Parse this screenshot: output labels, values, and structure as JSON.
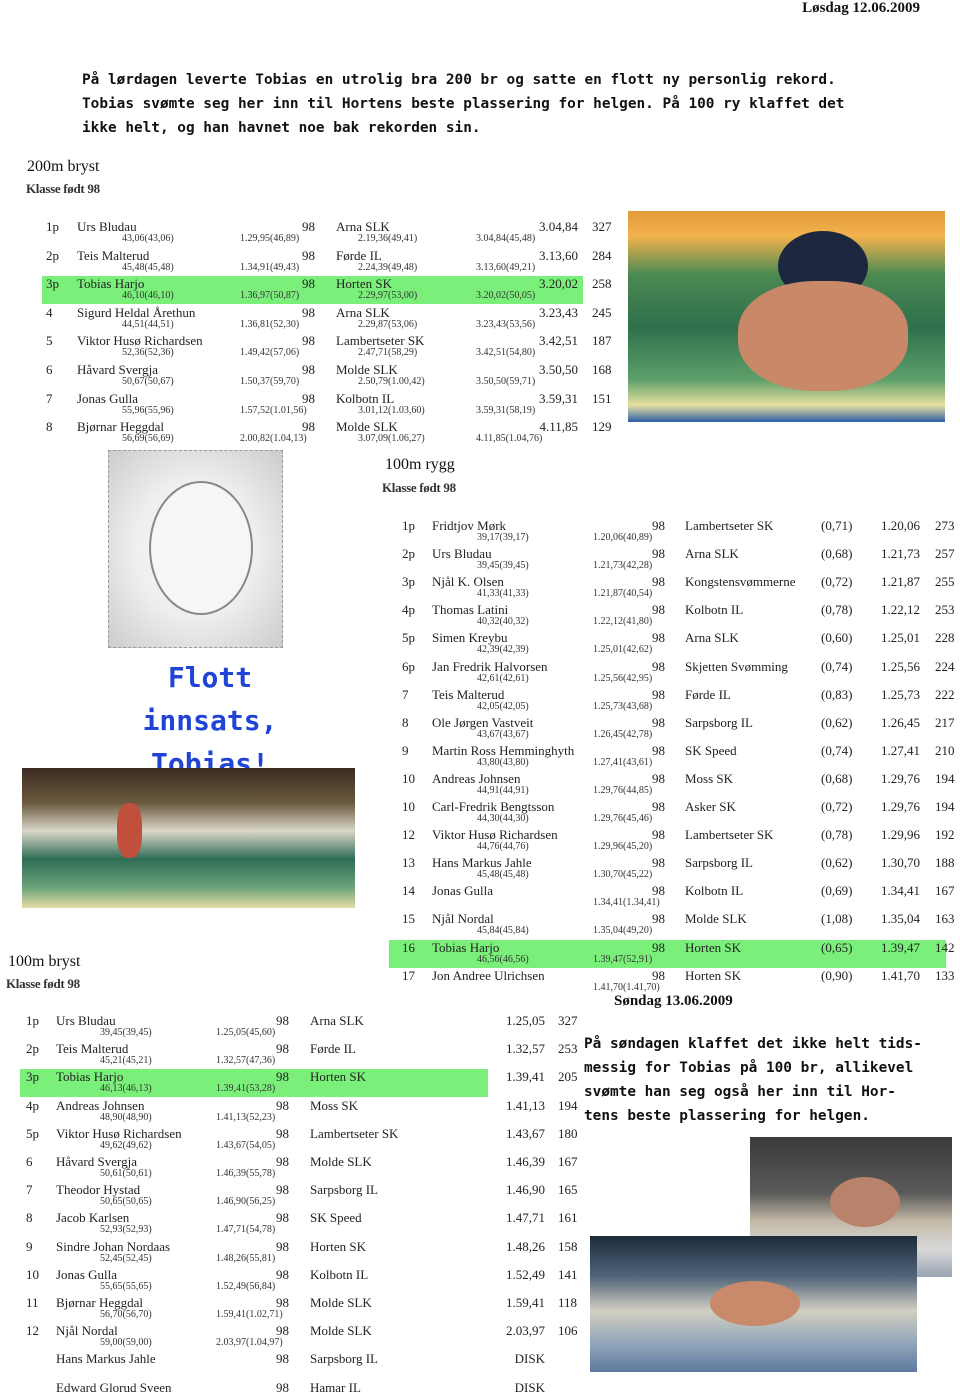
{
  "saturday": {
    "date": "Løsdag 12.06.2009",
    "text_lines": [
      "På lørdagen leverte Tobias en utrolig bra 200 br og satte en flott ny personlig rekord.",
      "Tobias svømte seg her inn til Hortens beste plassering for helgen. På 100 ry klaffet det",
      "ikke helt, og han havnet noe bak rekorden sin."
    ]
  },
  "event_200_bryst": {
    "title": "200m bryst",
    "class": "Klasse født 98",
    "highlight_index": 2,
    "rows": [
      [
        "1p",
        "Urs Bludau",
        "98",
        "Arna SLK",
        "3.04,84",
        "327",
        "43,06(43,06)",
        "1.29,95(46,89)",
        "2.19,36(49,41)",
        "3.04,84(45,48)"
      ],
      [
        "2p",
        "Teis Malterud",
        "98",
        "Førde IL",
        "3.13,60",
        "284",
        "45,48(45,48)",
        "1.34,91(49,43)",
        "2.24,39(49,48)",
        "3.13,60(49,21)"
      ],
      [
        "3p",
        "Tobias Harjo",
        "98",
        "Horten SK",
        "3.20,02",
        "258",
        "46,10(46,10)",
        "1.36,97(50,87)",
        "2.29,97(53,00)",
        "3.20,02(50,05)"
      ],
      [
        "4",
        "Sigurd Heldal Årethun",
        "98",
        "Arna SLK",
        "3.23,43",
        "245",
        "44,51(44,51)",
        "1.36,81(52,30)",
        "2.29,87(53,06)",
        "3.23,43(53,56)"
      ],
      [
        "5",
        "Viktor Husø Richardsen",
        "98",
        "Lambertseter SK",
        "3.42,51",
        "187",
        "52,36(52,36)",
        "1.49,42(57,06)",
        "2.47,71(58,29)",
        "3.42,51(54,80)"
      ],
      [
        "6",
        "Håvard Svergja",
        "98",
        "Molde SLK",
        "3.50,50",
        "168",
        "50,67(50,67)",
        "1.50,37(59,70)",
        "2.50,79(1.00,42)",
        "3.50,50(59,71)"
      ],
      [
        "7",
        "Jonas Gulla",
        "98",
        "Kolbotn IL",
        "3.59,31",
        "151",
        "55,96(55,96)",
        "1.57,52(1.01,56)",
        "3.01,12(1.03,60)",
        "3.59,31(58,19)"
      ],
      [
        "8",
        "Bjørnar Heggdal",
        "98",
        "Molde SLK",
        "4.11,85",
        "129",
        "56,69(56,69)",
        "2.00,82(1.04,13)",
        "3.07,09(1.06,27)",
        "4.11,85(1.04,76)"
      ]
    ]
  },
  "event_100_rygg": {
    "title": "100m rygg",
    "class": "Klasse født 98",
    "highlight_index": 15,
    "rows": [
      [
        "1p",
        "Fridtjov Mørk",
        "98",
        "Lambertseter SK",
        "(0,71)",
        "1.20,06",
        "273",
        "39,17(39,17)",
        "1.20,06(40,89)"
      ],
      [
        "2p",
        "Urs Bludau",
        "98",
        "Arna SLK",
        "(0,68)",
        "1.21,73",
        "257",
        "39,45(39,45)",
        "1.21,73(42,28)"
      ],
      [
        "3p",
        "Njål K. Olsen",
        "98",
        "Kongstensvømmerne",
        "(0,72)",
        "1.21,87",
        "255",
        "41,33(41,33)",
        "1.21,87(40,54)"
      ],
      [
        "4p",
        "Thomas Latini",
        "98",
        "Kolbotn IL",
        "(0,78)",
        "1.22,12",
        "253",
        "40,32(40,32)",
        "1.22,12(41,80)"
      ],
      [
        "5p",
        "Simen Kreybu",
        "98",
        "Arna SLK",
        "(0,60)",
        "1.25,01",
        "228",
        "42,39(42,39)",
        "1.25,01(42,62)"
      ],
      [
        "6p",
        "Jan Fredrik Halvorsen",
        "98",
        "Skjetten Svømming",
        "(0,74)",
        "1.25,56",
        "224",
        "42,61(42,61)",
        "1.25,56(42,95)"
      ],
      [
        "7",
        "Teis Malterud",
        "98",
        "Førde IL",
        "(0,83)",
        "1.25,73",
        "222",
        "42,05(42,05)",
        "1.25,73(43,68)"
      ],
      [
        "8",
        "Ole Jørgen Vastveit",
        "98",
        "Sarpsborg IL",
        "(0,62)",
        "1.26,45",
        "217",
        "43,67(43,67)",
        "1.26,45(42,78)"
      ],
      [
        "9",
        "Martin Ross Hemminghyth",
        "98",
        "SK Speed",
        "(0,74)",
        "1.27,41",
        "210",
        "43,80(43,80)",
        "1.27,41(43,61)"
      ],
      [
        "10",
        "Andreas Johnsen",
        "98",
        "Moss SK",
        "(0,68)",
        "1.29,76",
        "194",
        "44,91(44,91)",
        "1.29,76(44,85)"
      ],
      [
        "10",
        "Carl-Fredrik Bengtsson",
        "98",
        "Asker SK",
        "(0,72)",
        "1.29,76",
        "194",
        "44,30(44,30)",
        "1.29,76(45,46)"
      ],
      [
        "12",
        "Viktor Husø Richardsen",
        "98",
        "Lambertseter SK",
        "(0,78)",
        "1.29,96",
        "192",
        "44,76(44,76)",
        "1.29,96(45,20)"
      ],
      [
        "13",
        "Hans Markus Jahle",
        "98",
        "Sarpsborg IL",
        "(0,62)",
        "1.30,70",
        "188",
        "45,48(45,48)",
        "1.30,70(45,22)"
      ],
      [
        "14",
        "Jonas Gulla",
        "98",
        "Kolbotn IL",
        "(0,69)",
        "1.34,41",
        "167",
        "",
        "1.34,41(1.34,41)"
      ],
      [
        "15",
        "Njål Nordal",
        "98",
        "Molde SLK",
        "(1,08)",
        "1.35,04",
        "163",
        "45,84(45,84)",
        "1.35,04(49,20)"
      ],
      [
        "16",
        "Tobias Harjo",
        "98",
        "Horten SK",
        "(0,65)",
        "1.39,47",
        "142",
        "46,56(46,56)",
        "1.39,47(52,91)"
      ],
      [
        "17",
        "Jon Andree Ulrichsen",
        "98",
        "Horten SK",
        "(0,90)",
        "1.41,70",
        "133",
        "",
        "1.41,70(1.41,70)"
      ]
    ]
  },
  "event_100_bryst": {
    "title": "100m bryst",
    "class": "Klasse født 98",
    "highlight_index": 2,
    "rows": [
      [
        "1p",
        "Urs Bludau",
        "98",
        "Arna SLK",
        "1.25,05",
        "327",
        "39,45(39,45)",
        "1.25,05(45,60)"
      ],
      [
        "2p",
        "Teis Malterud",
        "98",
        "Førde IL",
        "1.32,57",
        "253",
        "45,21(45,21)",
        "1.32,57(47,36)"
      ],
      [
        "3p",
        "Tobias Harjo",
        "98",
        "Horten SK",
        "1.39,41",
        "205",
        "46,13(46,13)",
        "1.39,41(53,28)"
      ],
      [
        "4p",
        "Andreas Johnsen",
        "98",
        "Moss SK",
        "1.41,13",
        "194",
        "48,90(48,90)",
        "1.41,13(52,23)"
      ],
      [
        "5p",
        "Viktor Husø Richardsen",
        "98",
        "Lambertseter SK",
        "1.43,67",
        "180",
        "49,62(49,62)",
        "1.43,67(54,05)"
      ],
      [
        "6",
        "Håvard Svergja",
        "98",
        "Molde SLK",
        "1.46,39",
        "167",
        "50,61(50,61)",
        "1.46,39(55,78)"
      ],
      [
        "7",
        "Theodor Hystad",
        "98",
        "Sarpsborg IL",
        "1.46,90",
        "165",
        "50,65(50,65)",
        "1.46,90(56,25)"
      ],
      [
        "8",
        "Jacob Karlsen",
        "98",
        "SK Speed",
        "1.47,71",
        "161",
        "52,93(52,93)",
        "1.47,71(54,78)"
      ],
      [
        "9",
        "Sindre Johan Nordaas",
        "98",
        "Horten SK",
        "1.48,26",
        "158",
        "52,45(52,45)",
        "1.48,26(55,81)"
      ],
      [
        "10",
        "Jonas Gulla",
        "98",
        "Kolbotn IL",
        "1.52,49",
        "141",
        "55,65(55,65)",
        "1.52,49(56,84)"
      ],
      [
        "11",
        "Bjørnar Heggdal",
        "98",
        "Molde SLK",
        "1.59,41",
        "118",
        "56,70(56,70)",
        "1.59,41(1.02,71)"
      ],
      [
        "12",
        "Njål Nordal",
        "98",
        "Molde SLK",
        "2.03,97",
        "106",
        "59,00(59,00)",
        "2.03,97(1.04,97)"
      ],
      [
        "",
        "Hans Markus Jahle",
        "98",
        "Sarpsborg IL",
        "DISK",
        "",
        "",
        ""
      ],
      [
        "",
        "Edward Glorud Sveen",
        "98",
        "Hamar IL",
        "DISK",
        "",
        "",
        ""
      ]
    ]
  },
  "caption": {
    "line1": "Flott innsats,",
    "line2": "Tobias!"
  },
  "sunday": {
    "date": "Søndag 13.06.2009",
    "text_lines": [
      "På søndagen klaffet det ikke helt tids-",
      "messig for Tobias på 100 br, allikevel",
      "svømte han seg også her inn til Hor-",
      "tens beste plassering for helgen."
    ]
  },
  "colors": {
    "highlight": "#7af07a",
    "caption": "#1f44d6"
  }
}
